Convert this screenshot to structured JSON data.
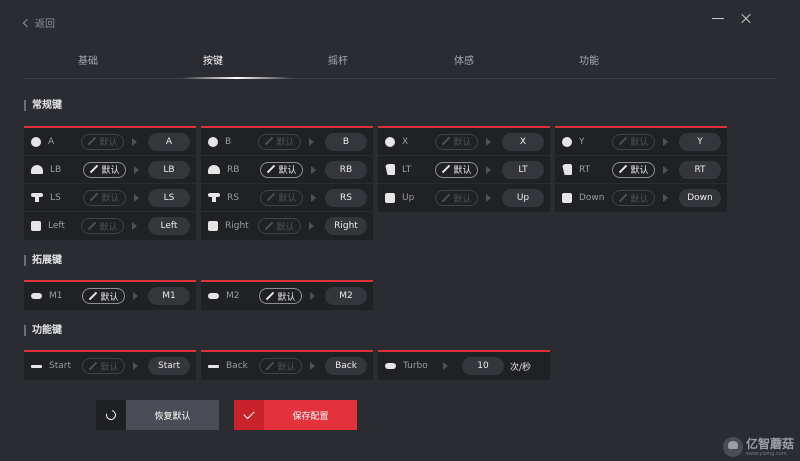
{
  "header": {
    "back_label": "返回"
  },
  "tabs": [
    {
      "label": "基础"
    },
    {
      "label": "按键"
    },
    {
      "label": "摇杆"
    },
    {
      "label": "体感"
    },
    {
      "label": "功能"
    }
  ],
  "sections": {
    "normal": "常规键",
    "extended": "拓展键",
    "function": "功能键"
  },
  "default_label": "默认",
  "cards": {
    "c1": [
      {
        "icon": "circle-icon",
        "name": "A",
        "mapped": "A",
        "custom": false
      },
      {
        "icon": "bumper-icon",
        "name": "LB",
        "mapped": "LB",
        "custom": true
      },
      {
        "icon": "stick-icon",
        "name": "LS",
        "mapped": "LS",
        "custom": false
      },
      {
        "icon": "square-icon",
        "name": "Left",
        "mapped": "Left",
        "custom": false
      }
    ],
    "c2": [
      {
        "icon": "circle-icon",
        "name": "B",
        "mapped": "B",
        "custom": false
      },
      {
        "icon": "bumper-icon",
        "name": "RB",
        "mapped": "RB",
        "custom": true
      },
      {
        "icon": "stick-icon",
        "name": "RS",
        "mapped": "RS",
        "custom": false
      },
      {
        "icon": "square-icon",
        "name": "Right",
        "mapped": "Right",
        "custom": false
      }
    ],
    "c3": [
      {
        "icon": "circle-icon",
        "name": "X",
        "mapped": "X",
        "custom": false
      },
      {
        "icon": "trigger-icon",
        "name": "LT",
        "mapped": "LT",
        "custom": true
      },
      {
        "icon": "square-icon",
        "name": "Up",
        "mapped": "Up",
        "custom": false
      }
    ],
    "c4": [
      {
        "icon": "circle-icon",
        "name": "Y",
        "mapped": "Y",
        "custom": false
      },
      {
        "icon": "trigger-icon",
        "name": "RT",
        "mapped": "RT",
        "custom": true
      },
      {
        "icon": "square-icon",
        "name": "Down",
        "mapped": "Down",
        "custom": false
      }
    ],
    "m1": [
      {
        "icon": "pill-icon",
        "name": "M1",
        "mapped": "M1",
        "custom": true
      }
    ],
    "m2": [
      {
        "icon": "pill-icon",
        "name": "M2",
        "mapped": "M2",
        "custom": true
      }
    ],
    "start": [
      {
        "icon": "bar-icon",
        "name": "Start",
        "mapped": "Start",
        "custom": false
      }
    ],
    "back": [
      {
        "icon": "bar-icon",
        "name": "Back",
        "mapped": "Back",
        "custom": false
      }
    ]
  },
  "turbo": {
    "icon": "pill-icon",
    "name": "Turbo",
    "value": "10",
    "unit": "次/秒"
  },
  "buttons": {
    "reset": "恢复默认",
    "save": "保存配置"
  },
  "watermark": {
    "main": "亿智蘑菇",
    "sub": "www.yizmg.com"
  },
  "colors": {
    "accent": "#e3323b",
    "background": "#2b2c31",
    "card": "#202124"
  }
}
